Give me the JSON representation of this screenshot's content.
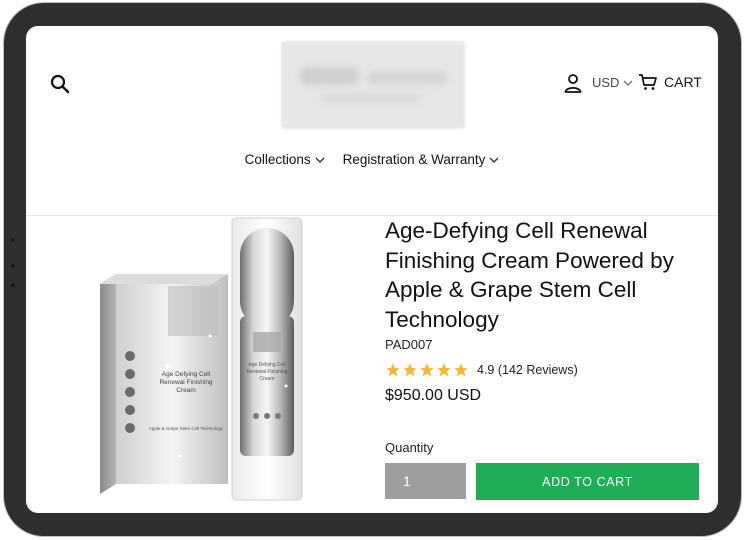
{
  "header": {
    "currency": "USD",
    "cart_label": "CART"
  },
  "nav": {
    "items": [
      {
        "label": "Collections"
      },
      {
        "label": "Registration & Warranty"
      }
    ]
  },
  "product": {
    "title": "Age-Defying Cell Renewal Finishing Cream Powered by Apple & Grape Stem Cell Technology",
    "sku": "PAD007",
    "rating": 4.9,
    "rating_text": "4.9 (142 Reviews)",
    "stars": 5,
    "price": "$950.00 USD",
    "quantity_label": "Quantity",
    "quantity_value": "1",
    "add_to_cart_label": "ADD TO CART",
    "box_text": {
      "title": "Age Defying Cell Renewal Finishing Cream",
      "subtitle": "Apple & Grape Stem Cell Technology"
    }
  },
  "colors": {
    "accent_green": "#1fae55",
    "star_gold": "#f5b82e",
    "quantity_gray": "#9e9e9e"
  }
}
